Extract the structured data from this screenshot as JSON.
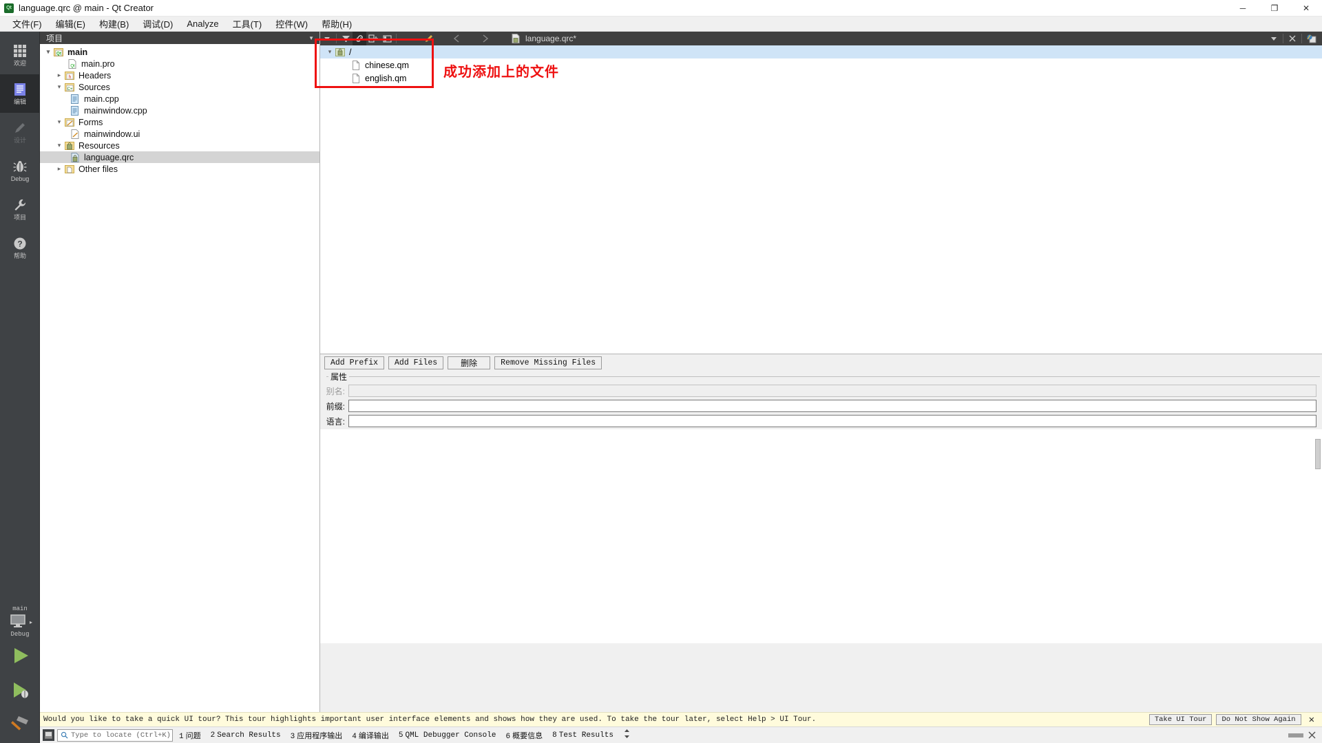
{
  "window": {
    "title": "language.qrc @ main - Qt Creator",
    "logo_text": "Qt",
    "minimize": "─",
    "maximize": "❐",
    "close": "✕"
  },
  "menubar": {
    "items": [
      {
        "name": "file",
        "label": "文件(F)"
      },
      {
        "name": "edit",
        "label": "编辑(E)"
      },
      {
        "name": "build",
        "label": "构建(B)"
      },
      {
        "name": "debug",
        "label": "调试(D)"
      },
      {
        "name": "analyze",
        "label": "Analyze"
      },
      {
        "name": "tools",
        "label": "工具(T)"
      },
      {
        "name": "widgets",
        "label": "控件(W)"
      },
      {
        "name": "help",
        "label": "帮助(H)"
      }
    ]
  },
  "modebar": {
    "modes": [
      {
        "name": "welcome",
        "label": "欢迎",
        "icon": "grid-icon",
        "state": "normal"
      },
      {
        "name": "edit",
        "label": "编辑",
        "icon": "document-lines-icon",
        "state": "active"
      },
      {
        "name": "design",
        "label": "设计",
        "icon": "pencil-icon",
        "state": "disabled"
      },
      {
        "name": "debug",
        "label": "Debug",
        "icon": "bug-icon",
        "state": "normal"
      },
      {
        "name": "projects",
        "label": "项目",
        "icon": "wrench-icon",
        "state": "normal"
      },
      {
        "name": "help",
        "label": "帮助",
        "icon": "question-circle-icon",
        "state": "normal"
      }
    ],
    "kit_name": "main",
    "kit_config": "Debug",
    "run_icon": "play-triangle-icon",
    "debug_icon": "play-bug-icon",
    "build_icon": "hammer-icon",
    "target_icon": "monitor-icon"
  },
  "project_panel": {
    "header": "项目",
    "tree": [
      {
        "label": "main",
        "icon": "qt-project-icon",
        "depth": 0,
        "arrow": "open",
        "bold": true,
        "selected": false
      },
      {
        "label": "main.pro",
        "icon": "qt-pro-file-icon",
        "depth": 1,
        "arrow": "none",
        "bold": false,
        "selected": false
      },
      {
        "label": "Headers",
        "icon": "headers-folder-icon",
        "depth": 1,
        "arrow": "closed",
        "bold": false,
        "selected": false
      },
      {
        "label": "Sources",
        "icon": "sources-folder-icon",
        "depth": 1,
        "arrow": "open",
        "bold": false,
        "selected": false
      },
      {
        "label": "main.cpp",
        "icon": "cpp-file-icon",
        "depth": 2,
        "arrow": "none",
        "bold": false,
        "selected": false
      },
      {
        "label": "mainwindow.cpp",
        "icon": "cpp-file-icon",
        "depth": 2,
        "arrow": "none",
        "bold": false,
        "selected": false
      },
      {
        "label": "Forms",
        "icon": "forms-folder-icon",
        "depth": 1,
        "arrow": "open",
        "bold": false,
        "selected": false
      },
      {
        "label": "mainwindow.ui",
        "icon": "ui-file-icon",
        "depth": 2,
        "arrow": "none",
        "bold": false,
        "selected": false
      },
      {
        "label": "Resources",
        "icon": "resources-folder-icon",
        "depth": 1,
        "arrow": "open",
        "bold": false,
        "selected": false
      },
      {
        "label": "language.qrc",
        "icon": "qrc-file-icon",
        "depth": 2,
        "arrow": "none",
        "bold": false,
        "selected": true
      },
      {
        "label": "Other files",
        "icon": "other-files-folder-icon",
        "depth": 1,
        "arrow": "closed",
        "bold": false,
        "selected": false
      }
    ]
  },
  "editor_toolbar": {
    "tab_name": "language.qrc*",
    "icons": [
      "chevron-down-icon",
      "filter-icon",
      "link-icon",
      "split-add-icon",
      "sidebar-icon",
      "pencil-icon",
      "back-arrow-icon",
      "forward-arrow-icon",
      "qrc-file-icon"
    ],
    "right_icons": [
      "chevron-down-icon",
      "close-icon",
      "split-editor-icon"
    ]
  },
  "resource_editor": {
    "rows": [
      {
        "label": "/",
        "icon": "prefix-icon",
        "depth": 0,
        "arrow": "open",
        "selected": true
      },
      {
        "label": "chinese.qm",
        "icon": "file-icon",
        "depth": 1,
        "arrow": "none",
        "selected": false
      },
      {
        "label": "english.qm",
        "icon": "file-icon",
        "depth": 1,
        "arrow": "none",
        "selected": false
      }
    ],
    "buttons": [
      {
        "name": "add-prefix-button",
        "label": "Add Prefix",
        "cn": false
      },
      {
        "name": "add-files-button",
        "label": "Add Files",
        "cn": false
      },
      {
        "name": "remove-button",
        "label": "删除",
        "cn": true
      },
      {
        "name": "remove-missing-files-button",
        "label": "Remove Missing Files",
        "cn": false
      }
    ],
    "properties": {
      "legend": "属性",
      "fields": [
        {
          "name": "alias-field",
          "label": "别名:",
          "value": "",
          "disabled": true
        },
        {
          "name": "prefix-field",
          "label": "前缀:",
          "value": "",
          "disabled": false
        },
        {
          "name": "language-field",
          "label": "语言:",
          "value": "",
          "disabled": false
        }
      ]
    }
  },
  "annotation": {
    "text": "成功添加上的文件",
    "color": "#ee1111"
  },
  "tourbar": {
    "message": "Would you like to take a quick UI tour? This tour highlights important user interface elements and shows how they are used. To take the tour later, select Help > UI Tour.",
    "take_tour": "Take UI Tour",
    "do_not_show": "Do Not Show Again",
    "close": "✕"
  },
  "statusbar": {
    "locator_placeholder": "Type to locate (Ctrl+K)",
    "search_icon": "search-icon",
    "panel_icon": "output-panel-icon",
    "items": [
      {
        "num": "1",
        "label": "问题"
      },
      {
        "num": "2",
        "label": "Search Results"
      },
      {
        "num": "3",
        "label": "应用程序输出"
      },
      {
        "num": "4",
        "label": "编译输出"
      },
      {
        "num": "5",
        "label": "QML Debugger Console"
      },
      {
        "num": "6",
        "label": "概要信息"
      },
      {
        "num": "8",
        "label": "Test Results"
      }
    ],
    "expand_icon": "up-down-arrows-icon"
  }
}
